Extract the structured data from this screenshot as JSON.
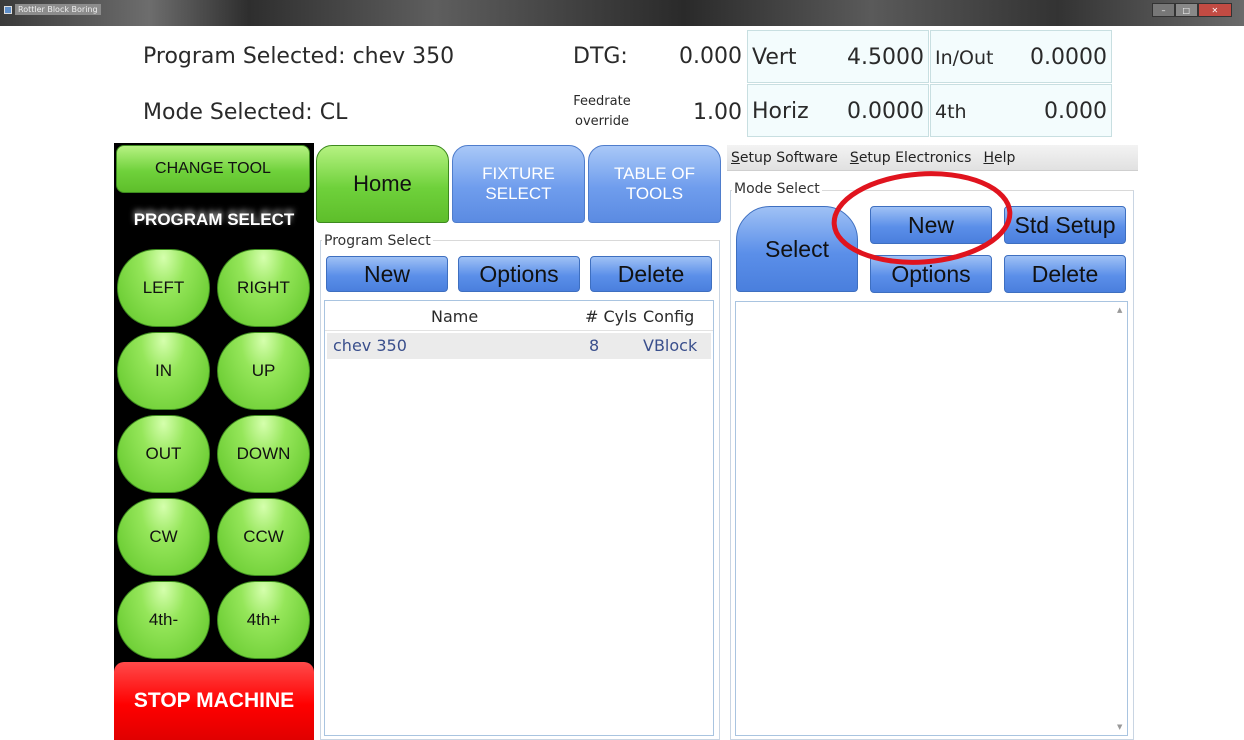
{
  "window": {
    "title": "Rottler Block Boring"
  },
  "header": {
    "program_label": "Program Selected: chev 350",
    "mode_label": "Mode Selected: CL",
    "dtg_label": "DTG:",
    "dtg_value": "0.000",
    "feedrate_label_line1": "Feedrate",
    "feedrate_label_line2": "override",
    "feedrate_value": "1.00",
    "vert_label": "Vert",
    "vert_value": "4.5000",
    "inout_label": "In/Out",
    "inout_value": "0.0000",
    "horiz_label": "Horiz",
    "horiz_value": "0.0000",
    "fourth_label": "4th",
    "fourth_value": "0.000"
  },
  "left_panel": {
    "change_tool": "CHANGE TOOL",
    "program_select_title": "PROGRAM SELECT",
    "jog_buttons": {
      "left": "LEFT",
      "right": "RIGHT",
      "in": "IN",
      "up": "UP",
      "out": "OUT",
      "down": "DOWN",
      "cw": "CW",
      "ccw": "CCW",
      "fourth_minus": "4th-",
      "fourth_plus": "4th+"
    },
    "stop_machine": "STOP MACHINE"
  },
  "nav_tabs": {
    "home": "Home",
    "fixture_select_line1": "FIXTURE",
    "fixture_select_line2": "SELECT",
    "table_of_tools_line1": "TABLE OF",
    "table_of_tools_line2": "TOOLS"
  },
  "program_select": {
    "group_label": "Program Select",
    "new_label": "New",
    "options_label": "Options",
    "delete_label": "Delete",
    "columns": {
      "name": "Name",
      "cyls": "# Cyls",
      "config": "Config"
    },
    "rows": [
      {
        "name": "chev 350",
        "cyls": "8",
        "config": "VBlock"
      }
    ]
  },
  "menu": {
    "setup_software": "Setup Software",
    "setup_electronics": "Setup Electronics",
    "help": "Help"
  },
  "mode_select": {
    "group_label": "Mode Select",
    "select_label": "Select",
    "new_label": "New",
    "std_setup_label": "Std Setup",
    "options_label": "Options",
    "delete_label": "Delete"
  },
  "colors": {
    "green_button": "#6fd13b",
    "blue_button": "#5b8fe9",
    "stop_red": "#ff0000",
    "highlight_circle": "#e0141e",
    "readout_bg": "#f3fcfd"
  }
}
